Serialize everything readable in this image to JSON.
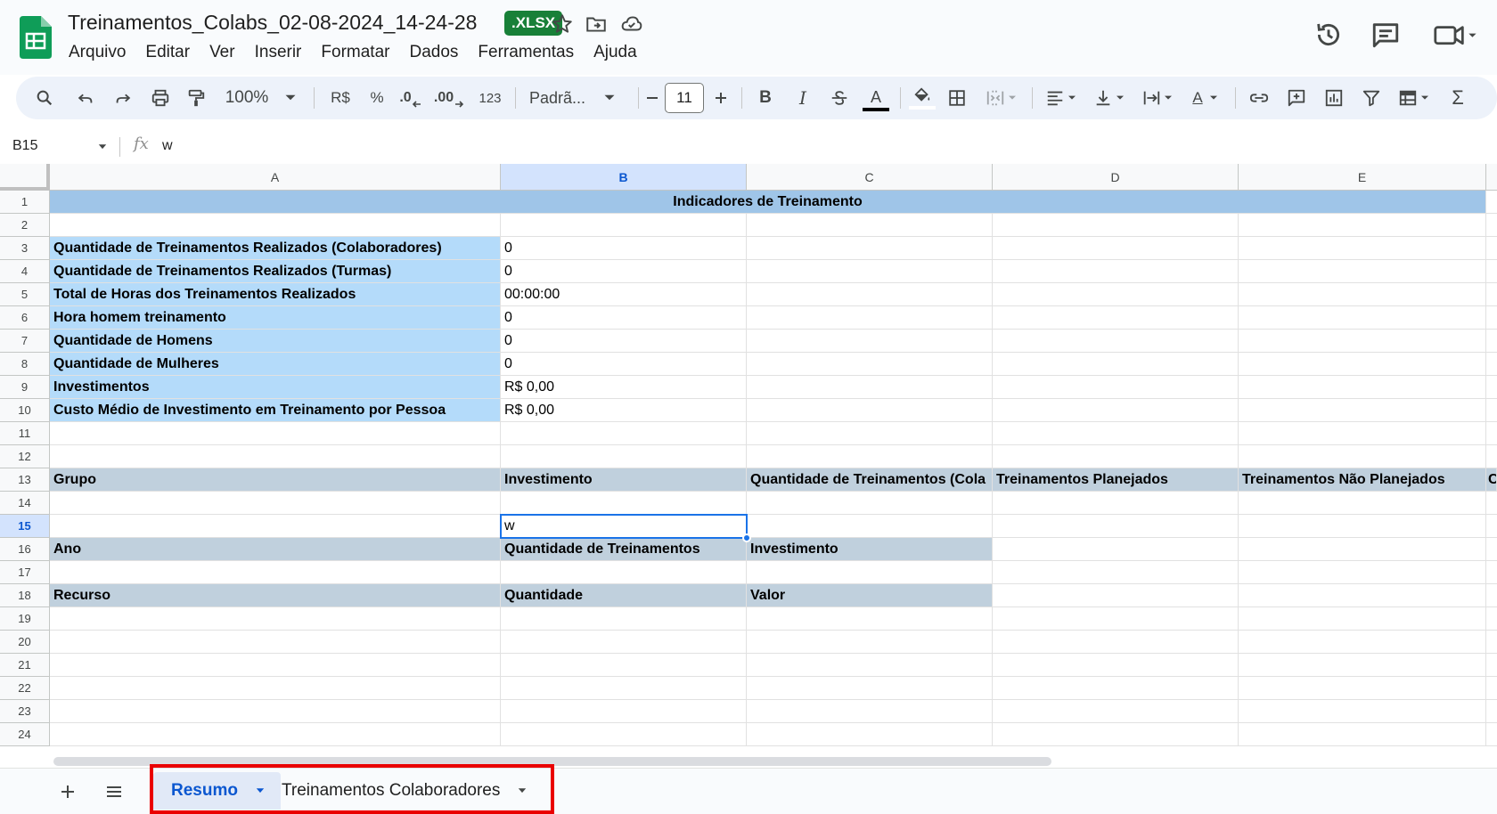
{
  "document": {
    "title": "Treinamentos_Colabs_02-08-2024_14-24-28",
    "badge": ".XLSX"
  },
  "menu": [
    "Arquivo",
    "Editar",
    "Ver",
    "Inserir",
    "Formatar",
    "Dados",
    "Ferramentas",
    "Ajuda"
  ],
  "toolbar": {
    "zoom": "100%",
    "currency": "R$",
    "percent": "%",
    "decrease_decimals": ".0",
    "increase_decimals": ".00",
    "number_format": "123",
    "font_name": "Padrã...",
    "font_size": "11",
    "bold": "B",
    "italic": "I",
    "text_color_letter": "A",
    "wrap_letter": "A",
    "sum": "Σ"
  },
  "formula_bar": {
    "cell_ref": "B15",
    "fx": "fx",
    "value": "w"
  },
  "columns": [
    "A",
    "B",
    "C",
    "D",
    "E"
  ],
  "rows": [
    "1",
    "2",
    "3",
    "4",
    "5",
    "6",
    "7",
    "8",
    "9",
    "10",
    "11",
    "12",
    "13",
    "14",
    "15",
    "16",
    "17",
    "18",
    "19",
    "20",
    "21",
    "22",
    "23",
    "24"
  ],
  "sheet": {
    "title_row": "Indicadores de Treinamento",
    "indicators": [
      {
        "label": "Quantidade de Treinamentos Realizados (Colaboradores)",
        "value": "0"
      },
      {
        "label": "Quantidade de Treinamentos Realizados (Turmas)",
        "value": "0"
      },
      {
        "label": "Total de Horas dos Treinamentos Realizados",
        "value": "00:00:00"
      },
      {
        "label": "Hora homem treinamento",
        "value": "0"
      },
      {
        "label": "Quantidade de Homens",
        "value": "0"
      },
      {
        "label": "Quantidade de Mulheres",
        "value": "0"
      },
      {
        "label": "Investimentos",
        "value": "R$ 0,00"
      },
      {
        "label": "Custo Médio de Investimento em Treinamento por Pessoa",
        "value": "R$ 0,00"
      }
    ],
    "group_header": [
      "Grupo",
      "Investimento",
      "Quantidade de Treinamentos (Cola",
      "Treinamentos Planejados",
      "Treinamentos Não Planejados",
      "C"
    ],
    "b15_value": "w",
    "year_header": [
      "Ano",
      "Quantidade de Treinamentos",
      "Investimento"
    ],
    "resource_header": [
      "Recurso",
      "Quantidade",
      "Valor"
    ]
  },
  "sheet_tabs": [
    {
      "label": "Resumo",
      "active": true
    },
    {
      "label": "Treinamentos Colaboradores",
      "active": false
    }
  ],
  "colors": {
    "title_fill": "#9fc5e8",
    "indicator_fill": "#b4dbfa",
    "table_header_fill": "#c0d0dd",
    "selection": "#1a73e8",
    "highlight": "#ea0000",
    "sheets_green": "#0f9d58"
  }
}
